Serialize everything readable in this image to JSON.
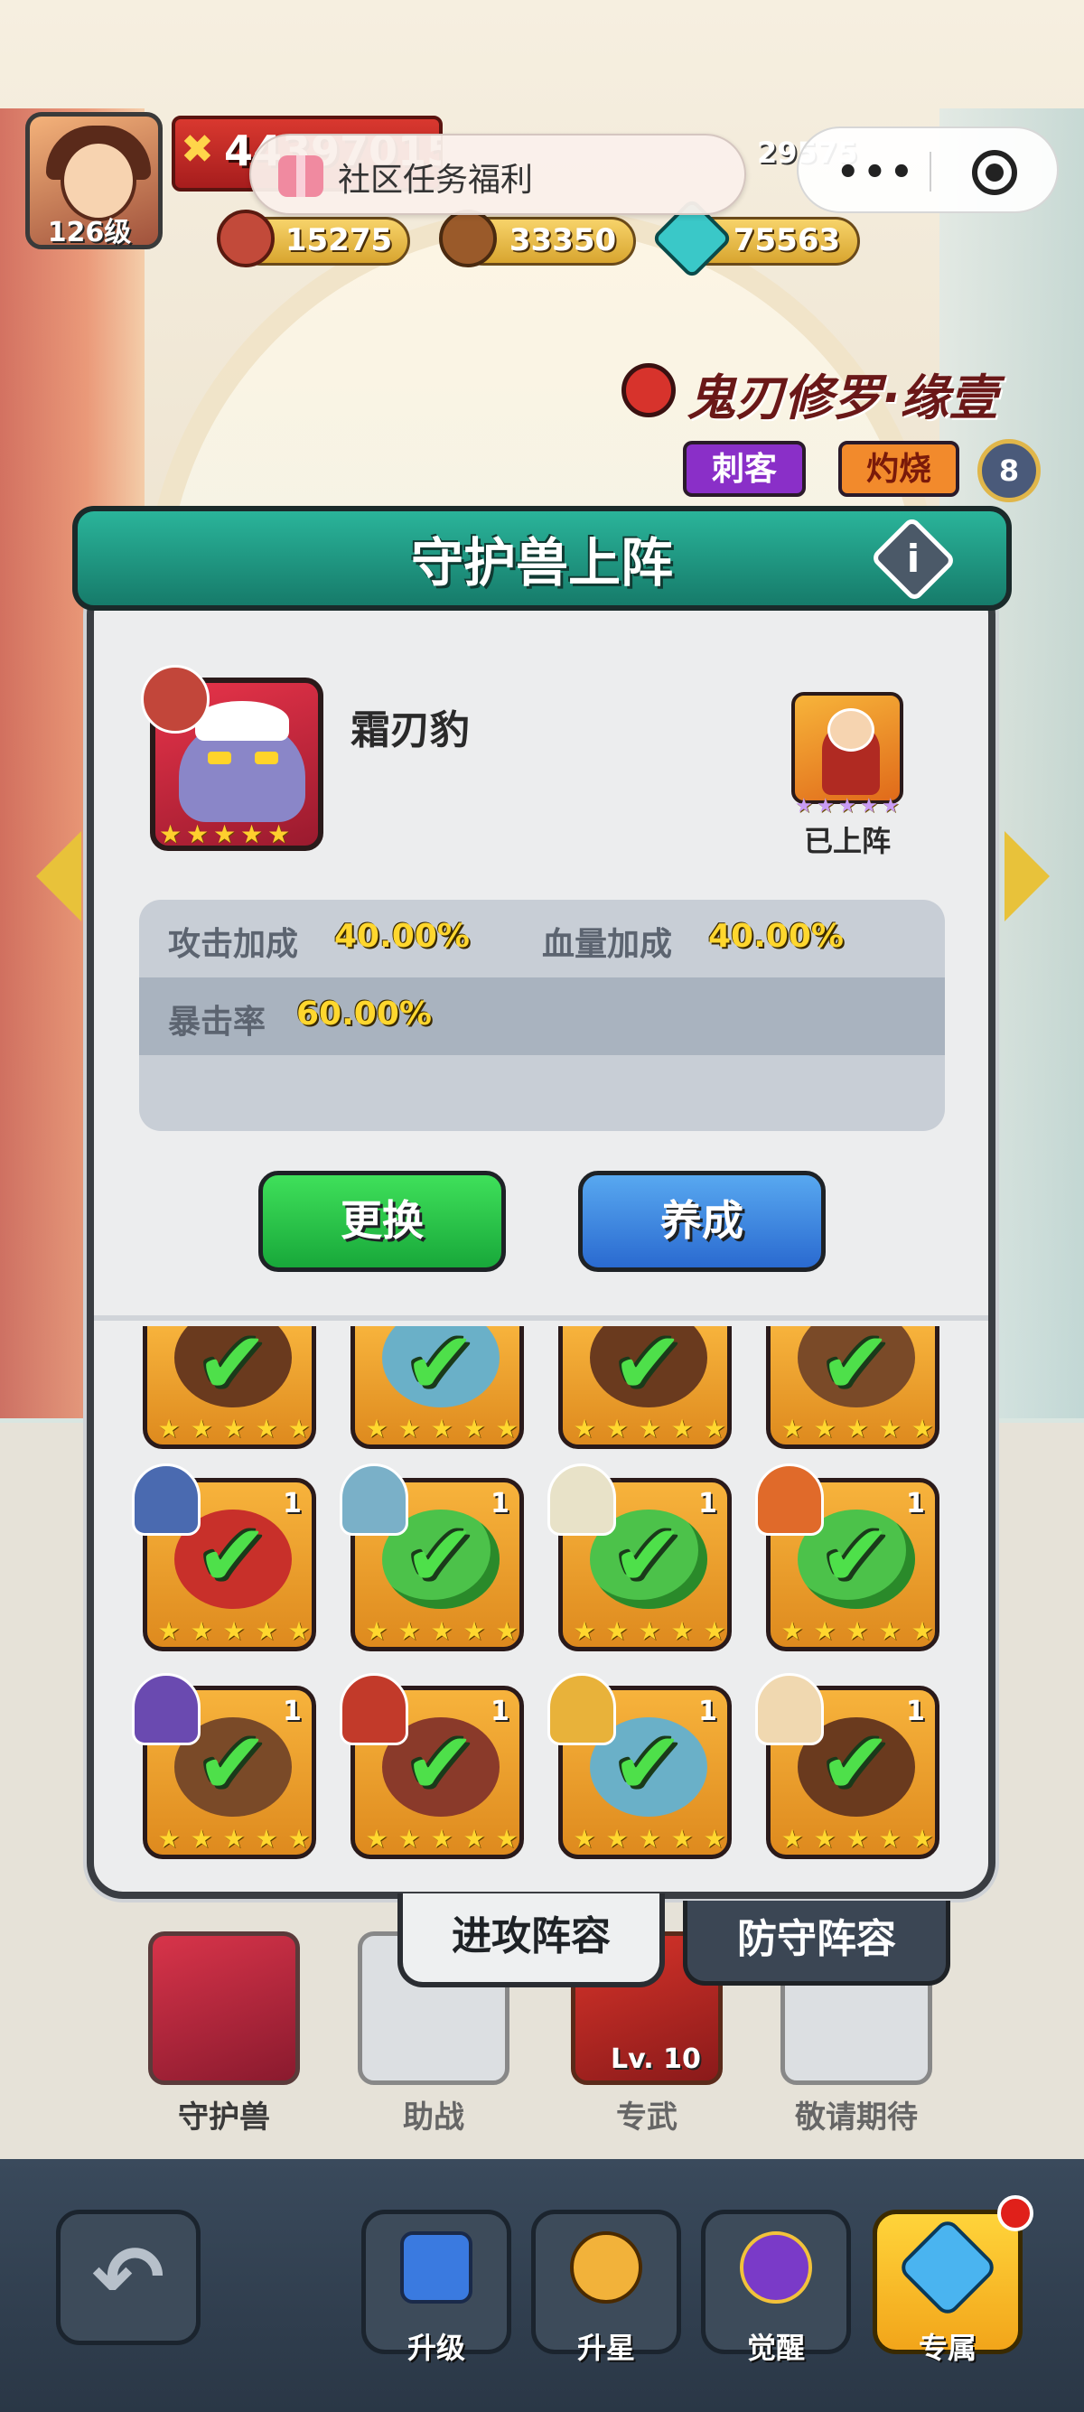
{
  "player": {
    "level_label": "126级",
    "power": "44397015",
    "right_stat": "29575"
  },
  "resources": [
    {
      "icon": "meat-icon",
      "value": "15275"
    },
    {
      "icon": "wood-icon",
      "value": "33350"
    },
    {
      "icon": "crystal-icon",
      "value": "75563"
    }
  ],
  "mini_program": {
    "banner_text": "社区任务福利",
    "more_glyph": "•••"
  },
  "hero": {
    "name": "鬼刃修罗·缘壹",
    "tags": [
      "刺客",
      "灼烧"
    ],
    "badge": "8"
  },
  "modal": {
    "title": "守护兽上阵",
    "info_glyph": "i",
    "beast": {
      "name": "霜刃豹",
      "stars": 5
    },
    "deployed_label": "已上阵",
    "stats": [
      {
        "label": "攻击加成",
        "value": "40.00%"
      },
      {
        "label": "血量加成",
        "value": "40.00%"
      },
      {
        "label": "暴击率",
        "value": "60.00%"
      }
    ],
    "buttons": {
      "change": "更换",
      "train": "养成"
    },
    "tabs": {
      "attack": "进攻阵容",
      "defense": "防守阵容"
    },
    "tile_count_label": "1",
    "star_glyph": "★",
    "check_glyph": "✔"
  },
  "slots": {
    "guardian": "守护兽",
    "assist": "助战",
    "weapon": "专武",
    "weapon_level": "Lv. 10",
    "coming": "敬请期待"
  },
  "nav": {
    "back_glyph": "↶",
    "upgrade": "升级",
    "star_up": "升星",
    "awaken": "觉醒",
    "exclusive": "专属"
  },
  "colors": {
    "header_teal": "#1f9a84",
    "button_green": "#22c246",
    "button_blue": "#3a82e0",
    "stat_yellow": "#ffd72e"
  }
}
